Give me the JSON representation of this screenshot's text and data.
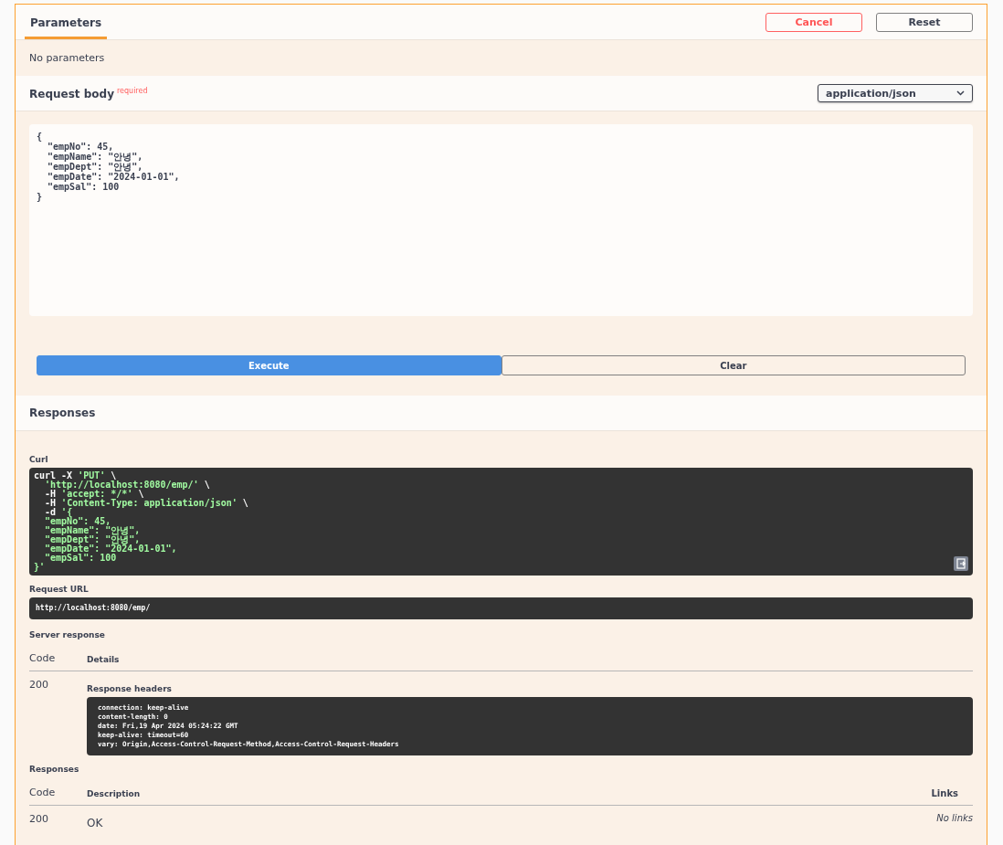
{
  "tabs": [
    {
      "label": "Parameters",
      "selected": true
    }
  ],
  "header_buttons": [
    {
      "label": "Cancel",
      "kind": "cancel"
    },
    {
      "label": "Reset",
      "kind": "reset"
    }
  ],
  "parameters_note": "No parameters",
  "request_body": {
    "title": "Request body",
    "required": "required",
    "content_type": "application/json",
    "value": "{\n  \"empNo\": 45,\n  \"empName\": \"안녕\",\n  \"empDept\": \"안녕\",\n  \"empDate\": \"2024-01-01\",\n  \"empSal\": 100\n}"
  },
  "actions": [
    {
      "label": "Execute",
      "kind": "primary"
    },
    {
      "label": "Clear",
      "kind": "secondary"
    }
  ],
  "responses_title": "Responses",
  "curl": {
    "label": "Curl",
    "lines": [
      [
        {
          "t": "curl -X ",
          "kind": "plain"
        },
        {
          "t": "'PUT'",
          "kind": "string"
        },
        {
          "t": " \\",
          "kind": "plain"
        }
      ],
      [
        {
          "t": "  'http://localhost:8080/emp/'",
          "kind": "string"
        },
        {
          "t": " \\",
          "kind": "plain"
        }
      ],
      [
        {
          "t": "  -H ",
          "kind": "plain"
        },
        {
          "t": "'accept: */*'",
          "kind": "string"
        },
        {
          "t": " \\",
          "kind": "plain"
        }
      ],
      [
        {
          "t": "  -H ",
          "kind": "plain"
        },
        {
          "t": "'Content-Type: application/json'",
          "kind": "string"
        },
        {
          "t": " \\",
          "kind": "plain"
        }
      ],
      [
        {
          "t": "  -d ",
          "kind": "plain"
        },
        {
          "t": "'{",
          "kind": "string"
        }
      ],
      [
        {
          "t": "  \"empNo\": 45,",
          "kind": "string"
        }
      ],
      [
        {
          "t": "  \"empName\": \"안녕\",",
          "kind": "string"
        }
      ],
      [
        {
          "t": "  \"empDept\": \"안녕\",",
          "kind": "string"
        }
      ],
      [
        {
          "t": "  \"empDate\": \"2024-01-01\",",
          "kind": "string"
        }
      ],
      [
        {
          "t": "  \"empSal\": 100",
          "kind": "string"
        }
      ],
      [
        {
          "t": "}'",
          "kind": "string"
        }
      ]
    ]
  },
  "request_url": {
    "label": "Request URL",
    "value": "http://localhost:8080/emp/"
  },
  "server_response": {
    "title": "Server response",
    "columns": [
      "Code",
      "Details"
    ],
    "code": "200",
    "headers_label": "Response headers",
    "headers": "connection: keep-alive\ncontent-length: 0\ndate: Fri,19 Apr 2024 05:24:22 GMT\nkeep-alive: timeout=60\nvary: Origin,Access-Control-Request-Method,Access-Control-Request-Headers"
  },
  "responses": {
    "title": "Responses",
    "columns": [
      "Code",
      "Description",
      "Links"
    ],
    "rows": [
      {
        "code": "200",
        "description": "OK",
        "links": "No links"
      }
    ]
  }
}
